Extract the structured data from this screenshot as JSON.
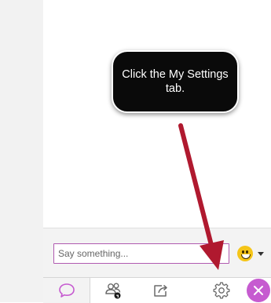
{
  "callout": {
    "line1": "Click the My Settings",
    "line2": "tab."
  },
  "chat_compose": {
    "placeholder": "Say something...",
    "emoji_button": "smiley-emoji-icon"
  },
  "tabs": [
    {
      "name": "chat",
      "icon": "chat-bubble-icon",
      "selected": true
    },
    {
      "name": "attendees",
      "icon": "attendees-icon",
      "selected": false
    },
    {
      "name": "share-content",
      "icon": "share-icon",
      "selected": false
    },
    {
      "name": "my-settings",
      "icon": "gear-icon",
      "selected": false
    }
  ],
  "close_button": {
    "icon": "close-icon"
  },
  "colors": {
    "accent": "#b05ab0",
    "arrow": "#b0192f",
    "callout_bg": "#0a0a0a",
    "tab_icon": "#6a6a6a",
    "chat_icon": "#c65bd0"
  }
}
